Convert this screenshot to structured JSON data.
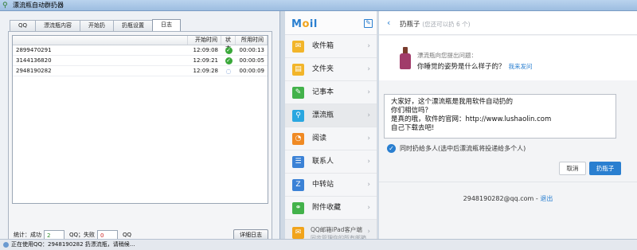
{
  "window": {
    "title": "漂流瓶自动群扔器"
  },
  "tabs": [
    {
      "label": "QQ"
    },
    {
      "label": "漂流瓶内容"
    },
    {
      "label": "开始扔"
    },
    {
      "label": "扔瓶设置"
    },
    {
      "label": "日志"
    }
  ],
  "log_table": {
    "headers": {
      "qq": "",
      "start": "开始时间",
      "status": "状态",
      "used": "所用时间"
    },
    "rows": [
      {
        "qq": "2899470291",
        "start": "12:09:08",
        "status": "done",
        "used": "00:00:13"
      },
      {
        "qq": "3144136820",
        "start": "12:09:21",
        "status": "done",
        "used": "00:00:05"
      },
      {
        "qq": "2948190282",
        "start": "12:09:28",
        "status": "running",
        "used": "00:00:09"
      }
    ]
  },
  "stats": {
    "label": "统计：成功",
    "success": "2",
    "fail_label": "QQ；失败",
    "fail": "0",
    "suffix": "QQ",
    "detail_button": "详细日志"
  },
  "statusbar": {
    "text": "正在使用QQ：2948190282 扔漂流瓶，请稍候..."
  },
  "mail": {
    "logo_left": "M",
    "logo_o": "o",
    "logo_right": "il",
    "menu": [
      {
        "label": "收件箱",
        "icon": "inbox-icon",
        "color": "#f2b52a",
        "glyph": "✉"
      },
      {
        "label": "文件夹",
        "icon": "folder-icon",
        "color": "#f2b52a",
        "glyph": "▤"
      },
      {
        "label": "记事本",
        "icon": "notepad-icon",
        "color": "#43b24b",
        "glyph": "✎"
      },
      {
        "label": "漂流瓶",
        "icon": "bottle-icon",
        "color": "#2aa7e0",
        "glyph": "⚲"
      },
      {
        "label": "阅读",
        "icon": "rss-icon",
        "color": "#f08a24",
        "glyph": "◔"
      },
      {
        "label": "联系人",
        "icon": "contacts-icon",
        "color": "#3b82d6",
        "glyph": "☰"
      },
      {
        "label": "中转站",
        "icon": "transfer-icon",
        "color": "#3b82d6",
        "glyph": "Z"
      },
      {
        "label": "附件收藏",
        "icon": "attachment-icon",
        "color": "#43b24b",
        "glyph": "⚭"
      }
    ],
    "promo": {
      "line1": "QQ邮箱iPad客户端",
      "line2": "同步管理你的所有邮箱"
    }
  },
  "bottle": {
    "title": "扔瓶子",
    "subtitle": "(您还可以扔 6 个)",
    "question_line1": "漂流瓶向您提出问题：",
    "question_text": "你睡觉的姿势是什么样子的？",
    "question_link": "我来发问",
    "message": "大家好，这个漂流瓶是我用软件自动扔的\n你们相信吗？\n是真的哦，软件的官网：http://www.lushaolin.com\n自己下载去吧!",
    "multi_check": "同时扔给多人(选中后漂流瓶将投递给多个人)",
    "cancel": "取消",
    "throw": "扔瓶子",
    "account": "2948190282@qq.com",
    "sep": " - ",
    "logout": "退出"
  }
}
